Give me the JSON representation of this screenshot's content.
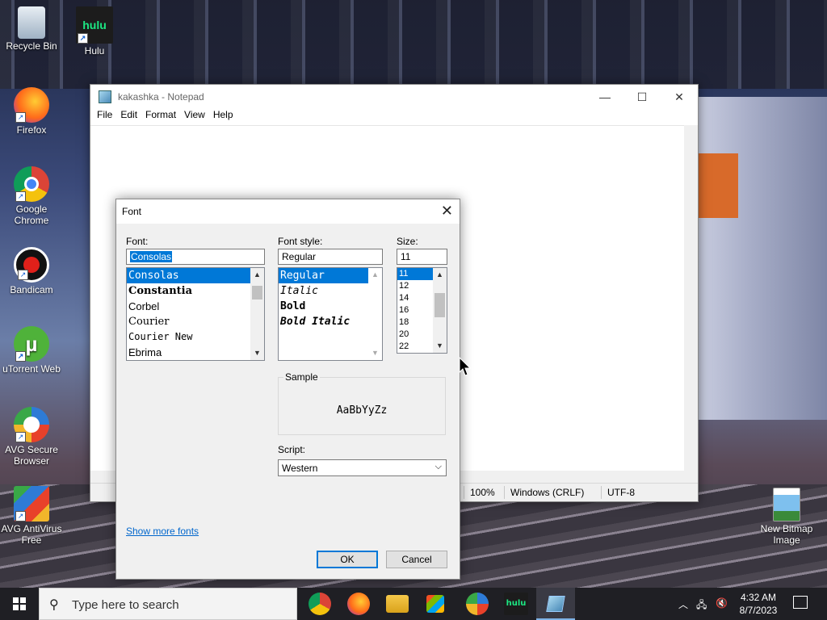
{
  "desktop": {
    "icons": [
      {
        "label": "Recycle Bin"
      },
      {
        "label": "Hulu"
      },
      {
        "label": "Firefox"
      },
      {
        "label": "Google Chrome"
      },
      {
        "label": "Bandicam"
      },
      {
        "label": "uTorrent Web"
      },
      {
        "label": "AVG Secure Browser"
      },
      {
        "label": "AVG AntiVirus Free"
      },
      {
        "label": "New Bitmap Image"
      }
    ],
    "hulu_tile_text": "hulu"
  },
  "notepad": {
    "title": "kakashka - Notepad",
    "menu": [
      "File",
      "Edit",
      "Format",
      "View",
      "Help"
    ],
    "status": {
      "zoom": "100%",
      "line_endings": "Windows (CRLF)",
      "encoding": "UTF-8"
    },
    "controls": {
      "minimize": "—",
      "maximize": "☐",
      "close": "✕"
    }
  },
  "font_dialog": {
    "title": "Font",
    "close": "✕",
    "font_label": "Font:",
    "font_value": "Consolas",
    "fonts": [
      "Consolas",
      "Constantia",
      "Corbel",
      "Courier",
      "Courier New",
      "Ebrima"
    ],
    "style_label": "Font style:",
    "style_value": "Regular",
    "styles": [
      "Regular",
      "Italic",
      "Bold",
      "Bold Italic"
    ],
    "size_label": "Size:",
    "size_value": "11",
    "sizes": [
      "11",
      "12",
      "14",
      "16",
      "18",
      "20",
      "22"
    ],
    "sample_label": "Sample",
    "sample_text": "AaBbYyZz",
    "script_label": "Script:",
    "script_value": "Western",
    "show_more": "Show more fonts",
    "ok": "OK",
    "cancel": "Cancel"
  },
  "taskbar": {
    "search_placeholder": "Type here to search",
    "hulu_text": "hulu",
    "time": "4:32 AM",
    "date": "8/7/2023"
  },
  "colors": {
    "accent": "#0078d7",
    "taskbar": "#1f1f24"
  }
}
